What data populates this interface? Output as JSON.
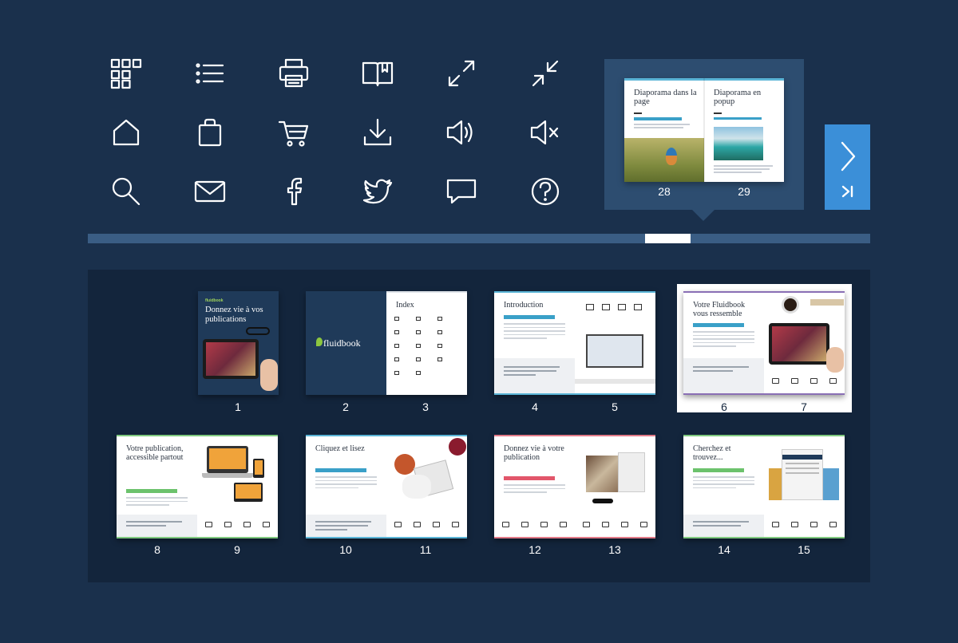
{
  "toolbar": {
    "icons": [
      "thumbnails-icon",
      "list-icon",
      "print-icon",
      "bookmark-book-icon",
      "fullscreen-icon",
      "exit-fullscreen-icon",
      "home-icon",
      "shopping-bag-icon",
      "cart-icon",
      "download-icon",
      "sound-on-icon",
      "sound-off-icon",
      "search-icon",
      "mail-icon",
      "facebook-icon",
      "twitter-icon",
      "chat-icon",
      "help-icon"
    ]
  },
  "preview": {
    "left_title": "Diaporama dans la page",
    "right_title": "Diaporama en popup",
    "left_page": "28",
    "right_page": "29"
  },
  "slider": {
    "position_fraction": 0.756
  },
  "thumbnails": {
    "cover_brand": "fluidbook",
    "cover_title": "Donnez vie à vos publications",
    "logo_text": "fluidbook",
    "index_title": "Index",
    "intro_title": "Introduction",
    "p6_title": "Votre Fluidbook vous ressemble",
    "p8_title": "Votre publication, accessible partout",
    "p10_title": "Cliquez et lisez",
    "p12_title": "Donnez vie à votre publication",
    "p14_title": "Cherchez et trouvez...",
    "page_numbers": [
      "1",
      "2",
      "3",
      "4",
      "5",
      "6",
      "7",
      "8",
      "9",
      "10",
      "11",
      "12",
      "13",
      "14",
      "15"
    ]
  },
  "colors": {
    "background": "#1a304c",
    "panel": "#13253c",
    "accent": "#3b8fd8",
    "slider_track": "#3a5d84"
  }
}
